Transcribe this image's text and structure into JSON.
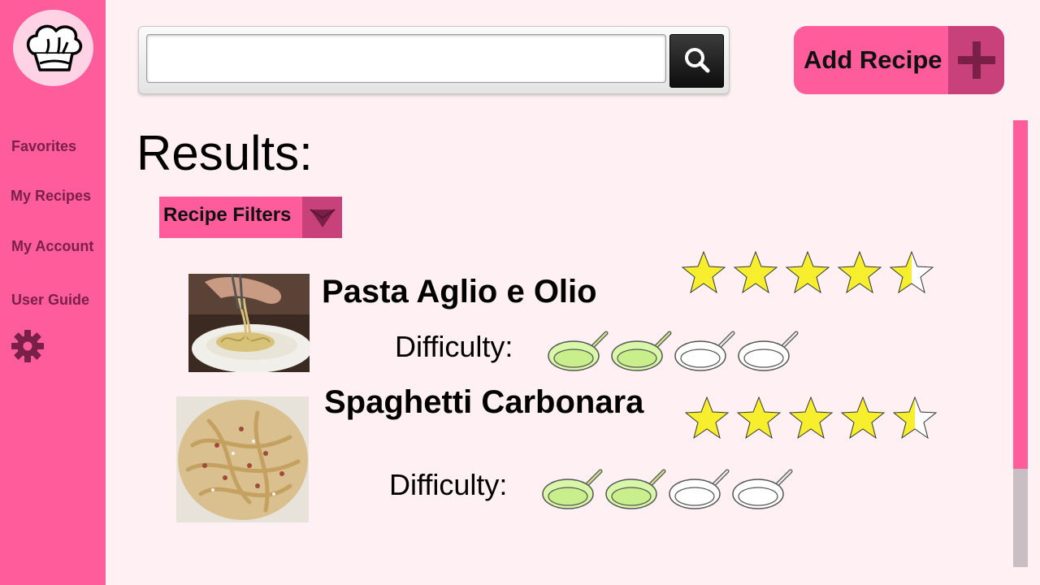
{
  "sidebar": {
    "logo": "chef-hat-icon",
    "items": [
      {
        "label": "Favorites"
      },
      {
        "label": "My Recipes"
      },
      {
        "label": "My Account"
      },
      {
        "label": "User Guide"
      }
    ],
    "settings_icon": "gear-icon"
  },
  "search": {
    "value": "",
    "placeholder": "",
    "button_icon": "search-icon"
  },
  "header": {
    "add_recipe_label": "Add Recipe",
    "add_icon": "plus-icon"
  },
  "main": {
    "title": "Results:",
    "filters_label": "Recipe Filters",
    "filters_icon": "triangle-down-icon",
    "recipes": [
      {
        "name": "Pasta Aglio e Olio",
        "difficulty_label": "Difficulty:",
        "rating": 4.5,
        "rating_max": 5,
        "difficulty": 2,
        "difficulty_max": 4
      },
      {
        "name": "Spaghetti Carbonara",
        "difficulty_label": "Difficulty:",
        "rating": 4.5,
        "rating_max": 5,
        "difficulty": 2,
        "difficulty_max": 4
      }
    ]
  },
  "colors": {
    "brand_pink": "#ff5c9c",
    "dark_pink": "#c8417a",
    "background": "#fff0f4",
    "star_fill": "#f7ee2e",
    "pan_fill": "#d8f7a8"
  },
  "scrollbar": {
    "position": 0.0,
    "visible_fraction": 0.78
  }
}
